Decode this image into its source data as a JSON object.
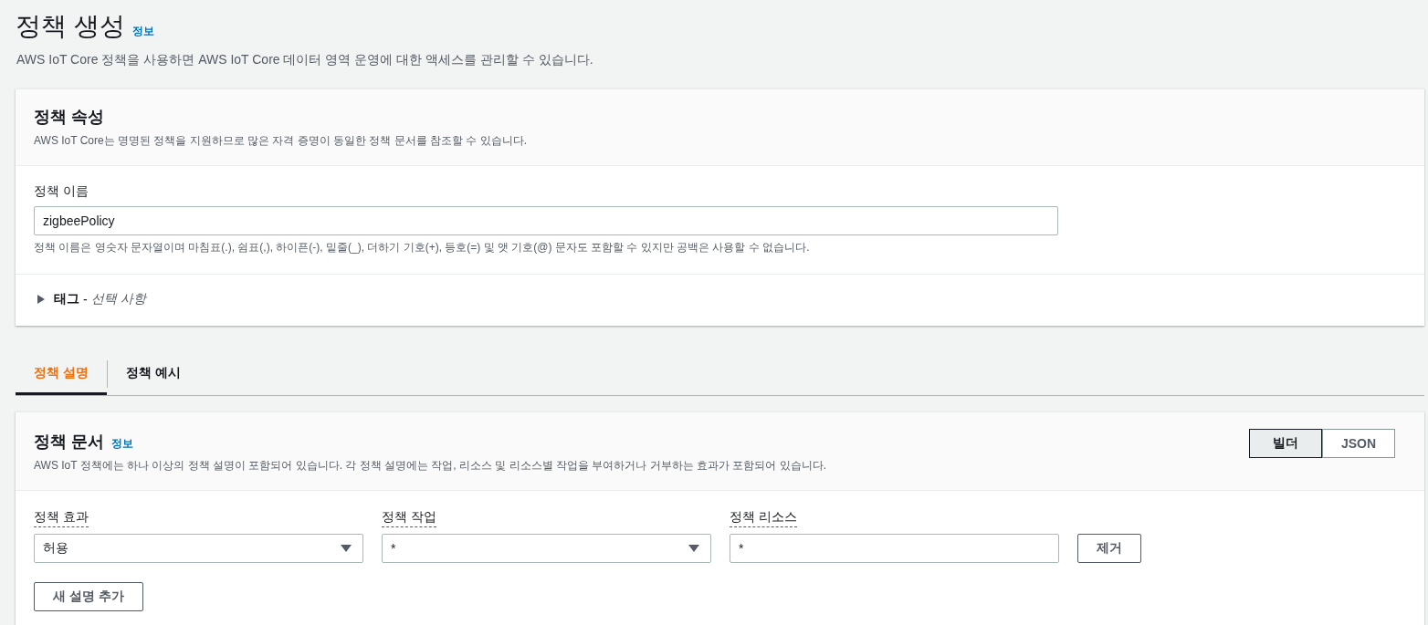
{
  "header": {
    "title": "정책 생성",
    "info_link": "정보",
    "description": "AWS IoT Core 정책을 사용하면 AWS IoT Core 데이터 영역 운영에 대한 액세스를 관리할 수 있습니다."
  },
  "properties_panel": {
    "title": "정책 속성",
    "description": "AWS IoT Core는 명명된 정책을 지원하므로 많은 자격 증명이 동일한 정책 문서를 참조할 수 있습니다.",
    "name_label": "정책 이름",
    "name_value": "zigbeePolicy",
    "name_hint": "정책 이름은 영숫자 문자열이며 마침표(.), 쉼표(,), 하이픈(-), 밑줄(_), 더하기 기호(+), 등호(=) 및 앳 기호(@) 문자도 포함할 수 있지만 공백은 사용할 수 없습니다.",
    "tags": {
      "label": "태그",
      "separator": "-",
      "optional": "선택 사항",
      "expanded": false
    }
  },
  "tabs": [
    {
      "label": "정책 설명",
      "selected": true
    },
    {
      "label": "정책 예시",
      "selected": false
    }
  ],
  "document_panel": {
    "title": "정책 문서",
    "info_link": "정보",
    "description": "AWS IoT 정책에는 하나 이상의 정책 설명이 포함되어 있습니다. 각 정책 설명에는 작업, 리소스 및 리소스별 작업을 부여하거나 거부하는 효과가 포함되어 있습니다.",
    "mode_toggle": [
      {
        "label": "빌더",
        "selected": true
      },
      {
        "label": "JSON",
        "selected": false
      }
    ],
    "statement_fields": [
      {
        "kind": "select",
        "label": "정책 효과",
        "value": "허용"
      },
      {
        "kind": "select",
        "label": "정책 작업",
        "value": "*"
      },
      {
        "kind": "input",
        "label": "정책 리소스",
        "value": "*"
      }
    ],
    "remove_button": "제거",
    "add_button": "새 설명 추가"
  }
}
